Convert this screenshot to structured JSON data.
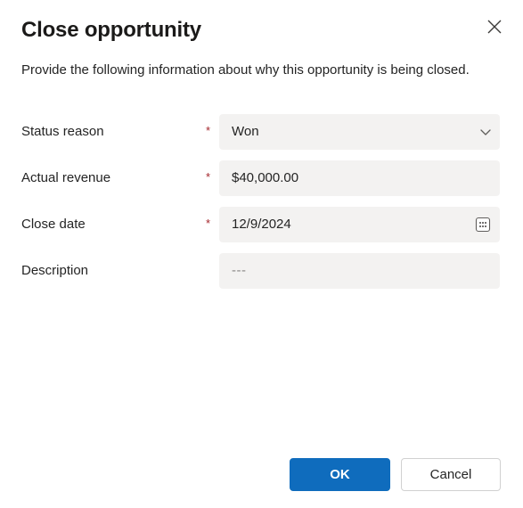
{
  "dialog": {
    "title": "Close opportunity",
    "subtitle": "Provide the following information about why this opportunity is being closed.",
    "close_icon": "close-icon",
    "accent_color": "#0f6cbd",
    "field_background": "#f3f2f1",
    "required_color": "#a4262c"
  },
  "form": {
    "fields": [
      {
        "label": "Status reason",
        "required": "*",
        "value": "Won",
        "type": "dropdown",
        "icon": "chevron-down-icon"
      },
      {
        "label": "Actual revenue",
        "required": "*",
        "value": "$40,000.00",
        "type": "text",
        "icon": ""
      },
      {
        "label": "Close date",
        "required": "*",
        "value": "12/9/2024",
        "type": "date",
        "icon": "calendar-icon"
      },
      {
        "label": "Description",
        "required": "",
        "value": "---",
        "type": "text",
        "icon": ""
      }
    ]
  },
  "footer": {
    "ok_label": "OK",
    "cancel_label": "Cancel"
  }
}
